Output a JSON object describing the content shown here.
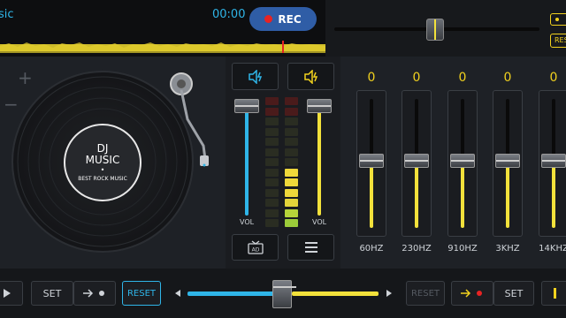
{
  "top": {
    "title": "sic",
    "time": "00:00",
    "rec_label": "REC",
    "reset_label": "RES"
  },
  "deck": {
    "plus": "+",
    "minus": "−",
    "label_line1": "DJ",
    "label_line2": "MUSIC",
    "label_dot": "•",
    "label_line3": "BEST ROCK MUSIC"
  },
  "mixer": {
    "vol_left": "VOL",
    "vol_right": "VOL",
    "left_vol_level": 0.88,
    "right_vol_level": 0.88,
    "speaker_left_icon": "speaker-lightning-icon",
    "speaker_right_icon": "speaker-lightning-icon",
    "tv_icon": "ad-tv-icon",
    "menu_icon": "menu-icon",
    "tv_icon_text": "AD"
  },
  "eq": {
    "bands": [
      {
        "value": "0",
        "label": "60HZ"
      },
      {
        "value": "0",
        "label": "230HZ"
      },
      {
        "value": "0",
        "label": "910HZ"
      },
      {
        "value": "0",
        "label": "3KHZ"
      },
      {
        "value": "0",
        "label": "14KHZ"
      }
    ]
  },
  "bottom": {
    "set_left": "SET",
    "reset_left": "RESET",
    "reset_right": "RESET",
    "set_right": "SET",
    "crossfader_position": 0.47
  },
  "colors": {
    "accent_blue": "#2fb5e8",
    "accent_yellow": "#f2d21e",
    "rec_red": "#e82323"
  }
}
